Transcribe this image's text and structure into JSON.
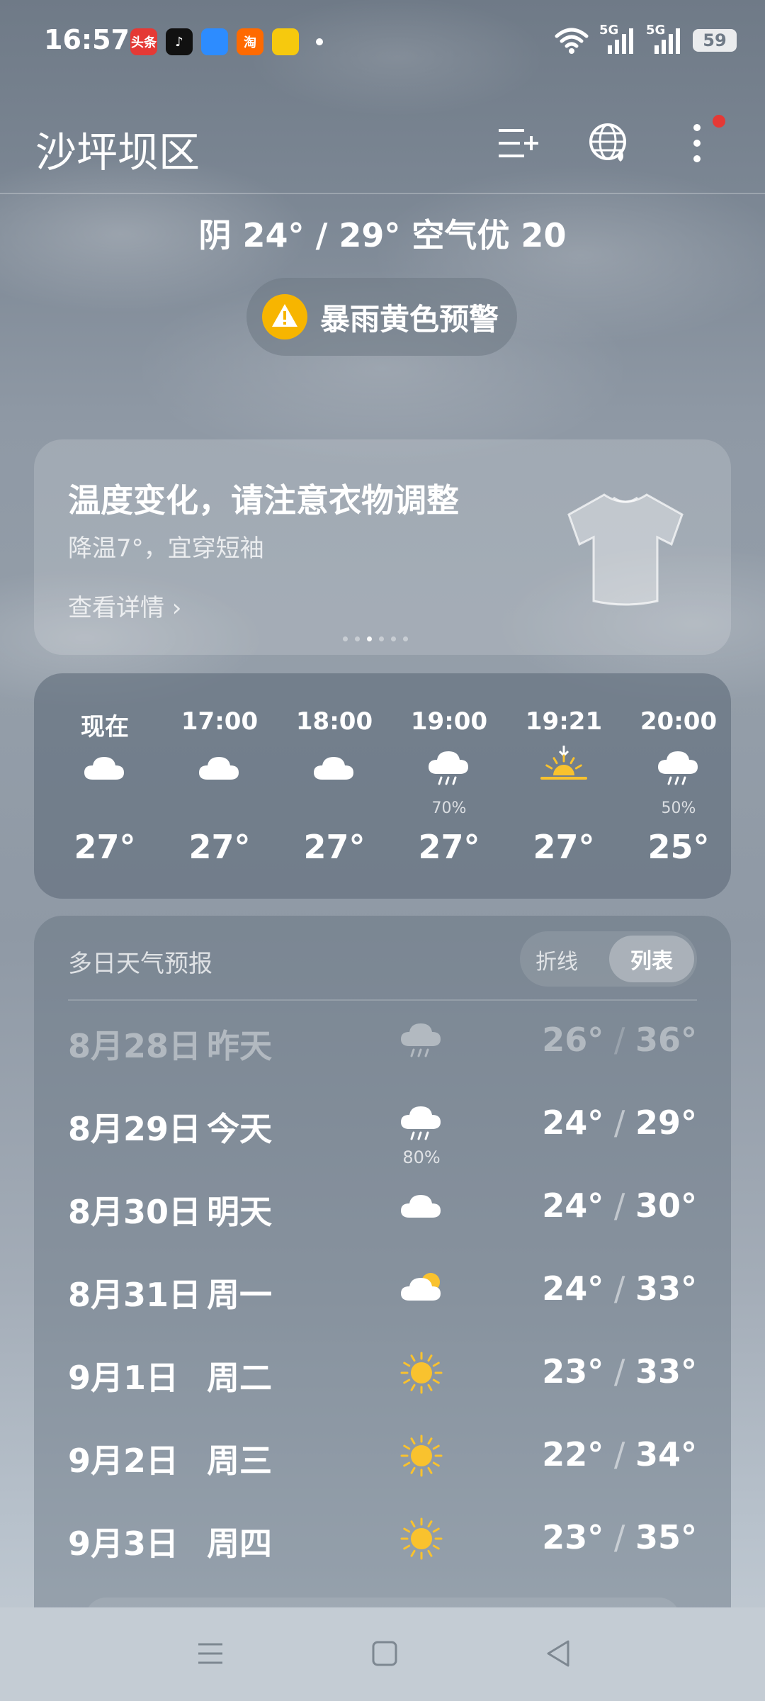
{
  "status_bar": {
    "time": "16:57",
    "app_icons": [
      {
        "name": "toutiao-icon",
        "label": "头条",
        "color": "#e53935"
      },
      {
        "name": "douyin-icon",
        "label": "♪",
        "color": "#111111"
      },
      {
        "name": "message-app-icon",
        "label": "",
        "color": "#2d8cff"
      },
      {
        "name": "taobao-icon",
        "label": "淘",
        "color": "#ff6a00"
      },
      {
        "name": "tuanyou-icon",
        "label": "",
        "color": "#f6c90e"
      }
    ],
    "network_labels": [
      "5G",
      "5G"
    ],
    "battery": "59"
  },
  "header": {
    "city": "沙坪坝区"
  },
  "summary": "阴  24° / 29°  空气优 20",
  "alert": {
    "text": "暴雨黄色预警",
    "color": "#f7b500"
  },
  "tip": {
    "title": "温度变化，请注意衣物调整",
    "subtitle": "降温7°，宜穿短袖",
    "link": "查看详情 ›",
    "pages": 6,
    "active_page": 3
  },
  "hourly": [
    {
      "time": "现在",
      "icon": "cloud-icon",
      "pct": "",
      "temp": "27°"
    },
    {
      "time": "17:00",
      "icon": "cloud-icon",
      "pct": "",
      "temp": "27°"
    },
    {
      "time": "18:00",
      "icon": "cloud-icon",
      "pct": "",
      "temp": "27°"
    },
    {
      "time": "19:00",
      "icon": "rain-icon",
      "pct": "70%",
      "temp": "27°"
    },
    {
      "time": "19:21",
      "icon": "sunset-icon",
      "pct": "",
      "temp": "27°"
    },
    {
      "time": "20:00",
      "icon": "rain-icon",
      "pct": "50%",
      "temp": "25°"
    }
  ],
  "daily": {
    "title": "多日天气预报",
    "toggle_line": "折线",
    "toggle_list": "列表",
    "rows": [
      {
        "date": "8月28日",
        "day": "昨天",
        "icon": "rain-icon",
        "pct": "",
        "low": "26°",
        "high": "36°",
        "faded": true
      },
      {
        "date": "8月29日",
        "day": "今天",
        "icon": "rain-icon",
        "pct": "80%",
        "low": "24°",
        "high": "29°",
        "faded": false
      },
      {
        "date": "8月30日",
        "day": "明天",
        "icon": "cloud-icon",
        "pct": "",
        "low": "24°",
        "high": "30°",
        "faded": false
      },
      {
        "date": "8月31日",
        "day": "周一",
        "icon": "partly-cloudy-icon",
        "pct": "",
        "low": "24°",
        "high": "33°",
        "faded": false
      },
      {
        "date": "9月1日",
        "day": "周二",
        "icon": "sun-icon",
        "pct": "",
        "low": "23°",
        "high": "33°",
        "faded": false
      },
      {
        "date": "9月2日",
        "day": "周三",
        "icon": "sun-icon",
        "pct": "",
        "low": "22°",
        "high": "34°",
        "faded": false
      },
      {
        "date": "9月3日",
        "day": "周四",
        "icon": "sun-icon",
        "pct": "",
        "low": "23°",
        "high": "35°",
        "faded": false
      }
    ]
  }
}
